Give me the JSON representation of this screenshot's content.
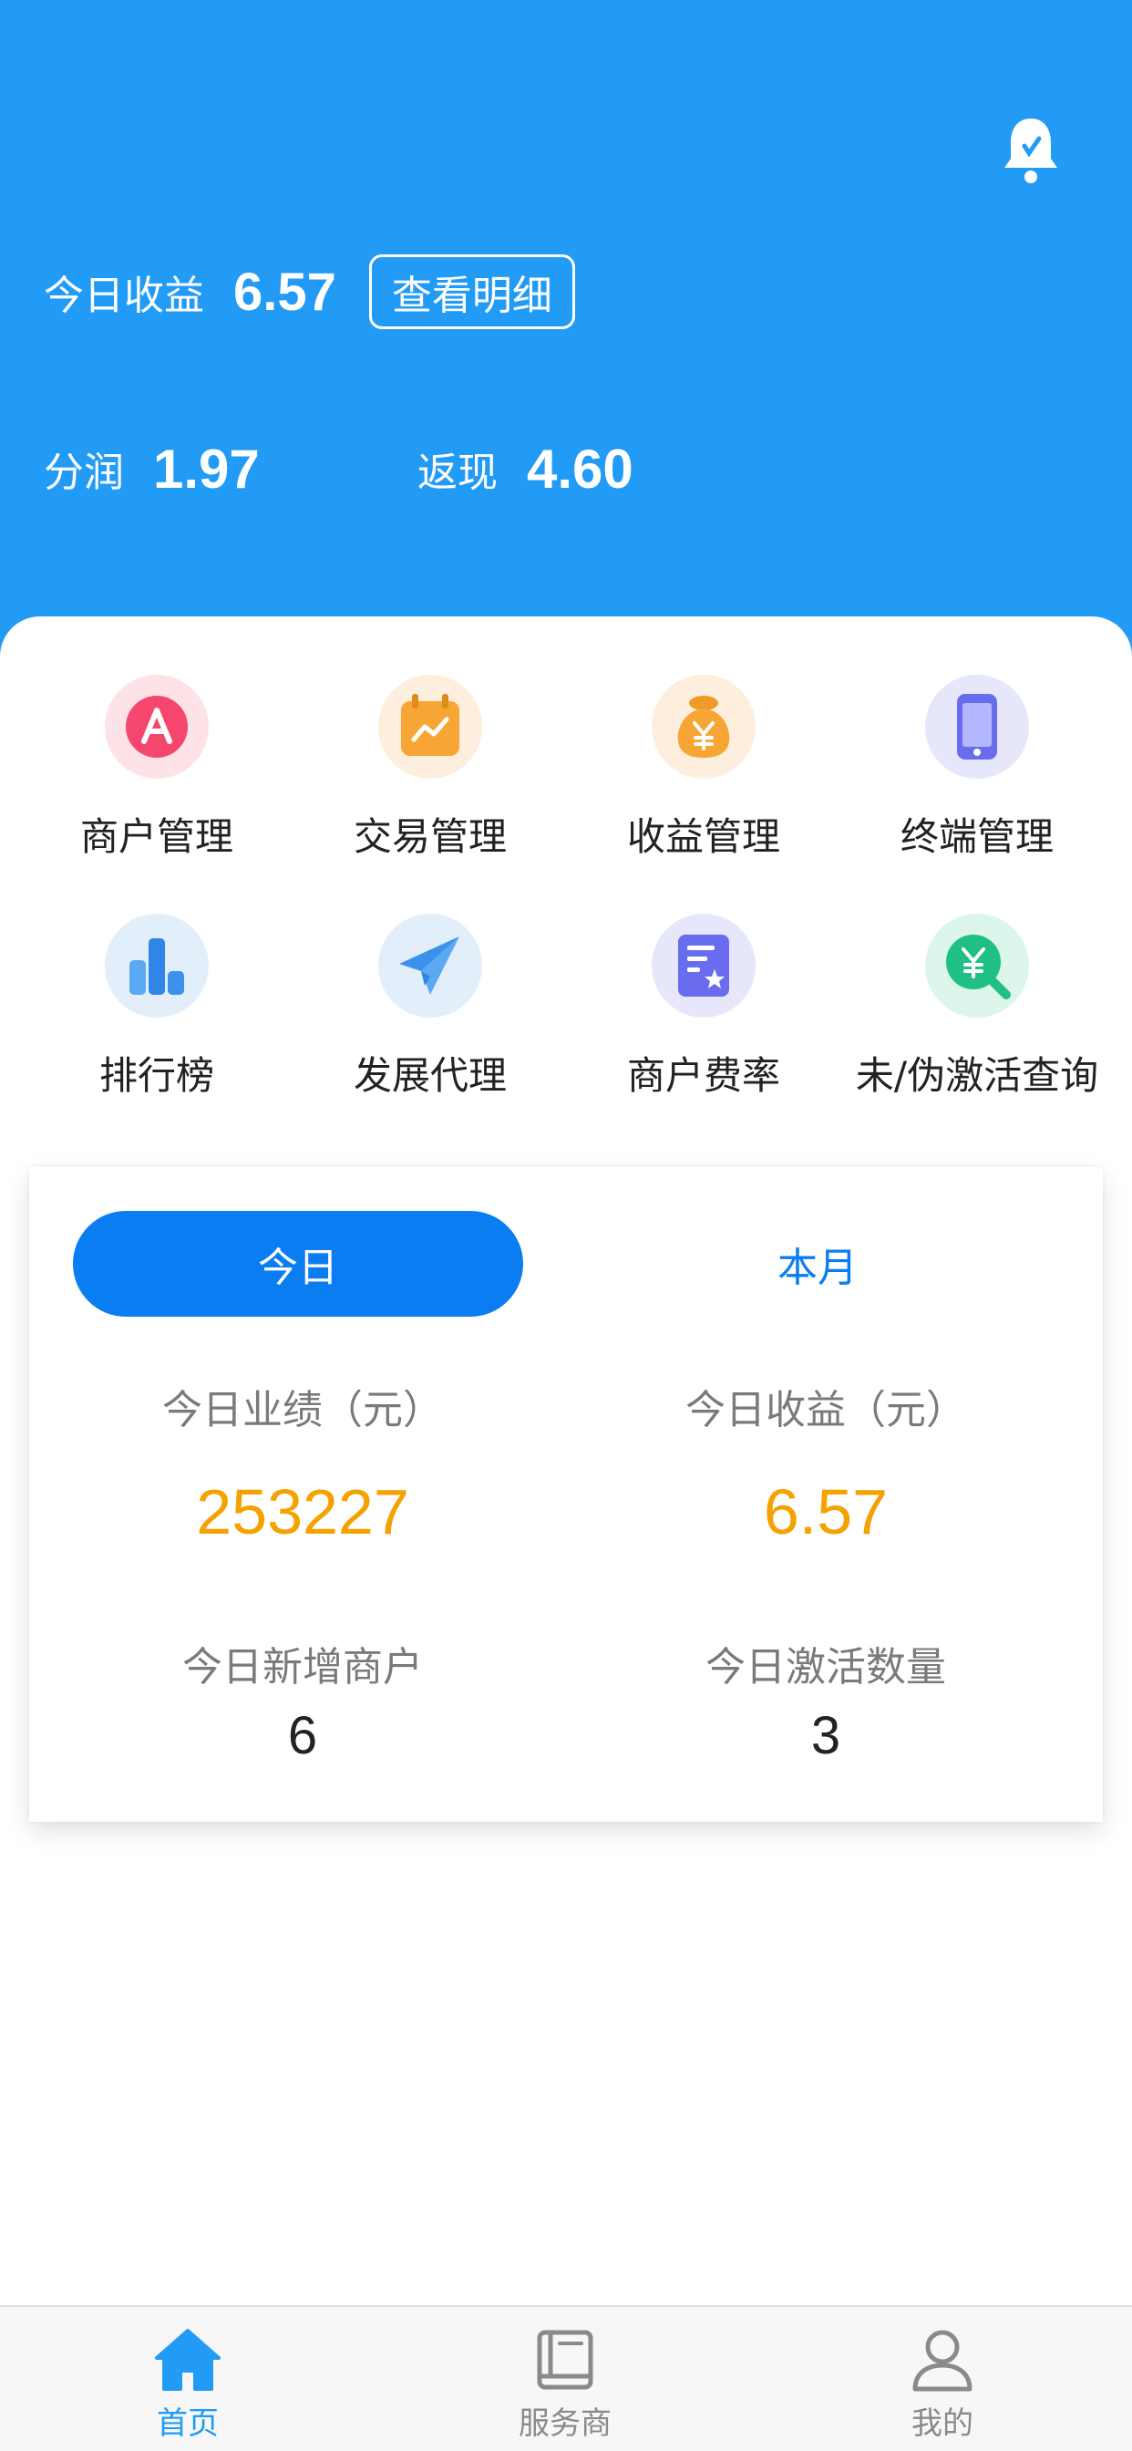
{
  "header": {
    "today_earnings_label": "今日收益",
    "today_earnings_value": "6.57",
    "detail_button": "查看明细",
    "profit_share_label": "分润",
    "profit_share_value": "1.97",
    "cashback_label": "返现",
    "cashback_value": "4.60",
    "bell_icon": "bell-icon"
  },
  "menu": {
    "items": [
      {
        "label": "商户管理",
        "icon": "merchant-icon"
      },
      {
        "label": "交易管理",
        "icon": "calendar-chart-icon"
      },
      {
        "label": "收益管理",
        "icon": "money-bag-icon"
      },
      {
        "label": "终端管理",
        "icon": "phone-icon"
      },
      {
        "label": "排行榜",
        "icon": "bar-chart-icon"
      },
      {
        "label": "发展代理",
        "icon": "paper-plane-icon"
      },
      {
        "label": "商户费率",
        "icon": "document-star-icon"
      },
      {
        "label": "未/伪激活查询",
        "icon": "yuan-search-icon"
      }
    ]
  },
  "stats": {
    "tabs": {
      "today": "今日",
      "month": "本月"
    },
    "performance_label": "今日业绩（元）",
    "performance_value": "253227",
    "earnings_label": "今日收益（元）",
    "earnings_value": "6.57",
    "new_merchants_label": "今日新增商户",
    "new_merchants_value": "6",
    "activations_label": "今日激活数量",
    "activations_value": "3"
  },
  "bottom_nav": {
    "items": [
      {
        "label": "首页",
        "icon": "home-icon",
        "active": true
      },
      {
        "label": "服务商",
        "icon": "book-icon",
        "active": false
      },
      {
        "label": "我的",
        "icon": "user-icon",
        "active": false
      }
    ]
  },
  "colors": {
    "header_bg": "#219bf6",
    "accent_blue": "#0a7df3",
    "value_orange": "#f5a100"
  }
}
